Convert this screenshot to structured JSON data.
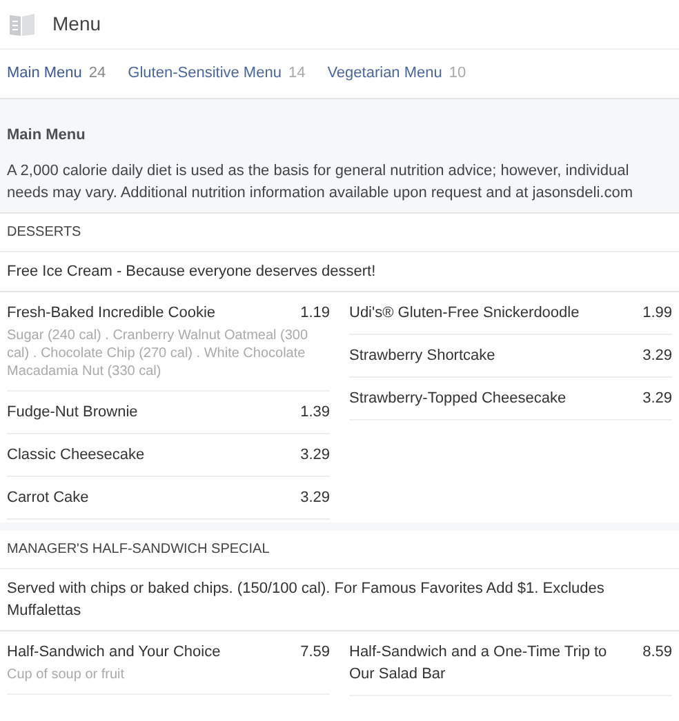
{
  "header": {
    "title": "Menu"
  },
  "tabs": [
    {
      "label": "Main Menu",
      "count": "24",
      "selected": true
    },
    {
      "label": "Gluten-Sensitive Menu",
      "count": "14",
      "selected": false
    },
    {
      "label": "Vegetarian Menu",
      "count": "10",
      "selected": false
    }
  ],
  "intro": {
    "title": "Main Menu",
    "text": "A 2,000 calorie daily diet is used as the basis for general nutrition advice; however, individual needs may vary. Additional nutrition information available upon request and at jasonsdeli.com"
  },
  "sections": [
    {
      "title": "DESSERTS",
      "note": "Free Ice Cream - Because everyone deserves dessert!",
      "columns": [
        [
          {
            "name": "Fresh-Baked Incredible Cookie",
            "price": "1.19",
            "description": "Sugar (240 cal) . Cranberry Walnut Oatmeal (300 cal) . Chocolate Chip (270 cal) . White Chocolate Macadamia Nut (330 cal)"
          },
          {
            "name": "Fudge-Nut Brownie",
            "price": "1.39"
          },
          {
            "name": "Classic Cheesecake",
            "price": "3.29"
          },
          {
            "name": "Carrot Cake",
            "price": "3.29"
          }
        ],
        [
          {
            "name": "Udi's® Gluten-Free Snickerdoodle",
            "price": "1.99"
          },
          {
            "name": "Strawberry Shortcake",
            "price": "3.29"
          },
          {
            "name": "Strawberry-Topped Cheesecake",
            "price": "3.29"
          }
        ]
      ]
    },
    {
      "title": "MANAGER'S HALF-SANDWICH SPECIAL",
      "note": "Served with chips or baked chips. (150/100 cal). For Famous Favorites Add $1. Excludes Muffalettas",
      "columns": [
        [
          {
            "name": "Half-Sandwich and Your Choice",
            "price": "7.59",
            "description": "Cup of soup or fruit"
          }
        ],
        [
          {
            "name": "Half-Sandwich and a One-Time Trip to Our Salad Bar",
            "price": "8.59"
          }
        ]
      ]
    }
  ]
}
